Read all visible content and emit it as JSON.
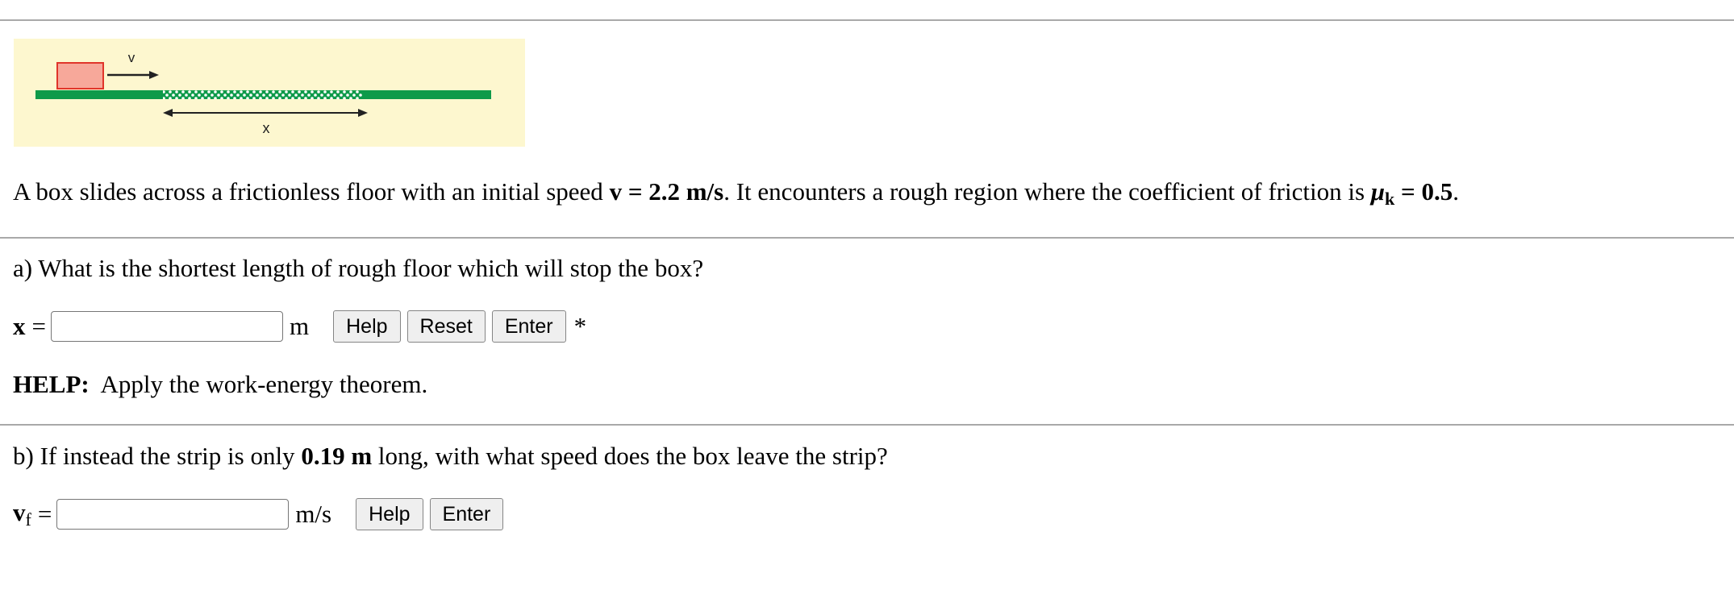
{
  "figure": {
    "velocity_label": "v",
    "distance_label": "x",
    "colors": {
      "background": "#fdf7cf",
      "floor": "#0e9a4a",
      "rough_strip": "#6ed095",
      "box_fill": "#f7a89a",
      "box_border": "#e0352a"
    }
  },
  "problem": {
    "intro_before_speed": "A box slides across a frictionless floor with an initial speed ",
    "speed": "v = 2.2 m/s",
    "intro_middle": ". It encounters a rough region where the coefficient of friction is ",
    "mu_symbol": "μ",
    "mu_subscript": "k",
    "mu_value": " = 0.5",
    "intro_end": "."
  },
  "part_a": {
    "question": "a) What is the shortest length of rough floor which will stop the box?",
    "variable": "x",
    "equals": "=",
    "input_value": "",
    "unit": "m",
    "buttons": {
      "help": "Help",
      "reset": "Reset",
      "enter": "Enter"
    },
    "marker": "*",
    "help_heading": "HELP:",
    "help_text": "Apply the work-energy theorem."
  },
  "part_b": {
    "question_before": "b) If instead the strip is only ",
    "length": "0.19 m",
    "question_after": " long, with what speed does the box leave the strip?",
    "variable": "v",
    "variable_subscript": "f",
    "equals": "=",
    "input_value": "",
    "unit": "m/s",
    "buttons": {
      "help": "Help",
      "enter": "Enter"
    }
  }
}
